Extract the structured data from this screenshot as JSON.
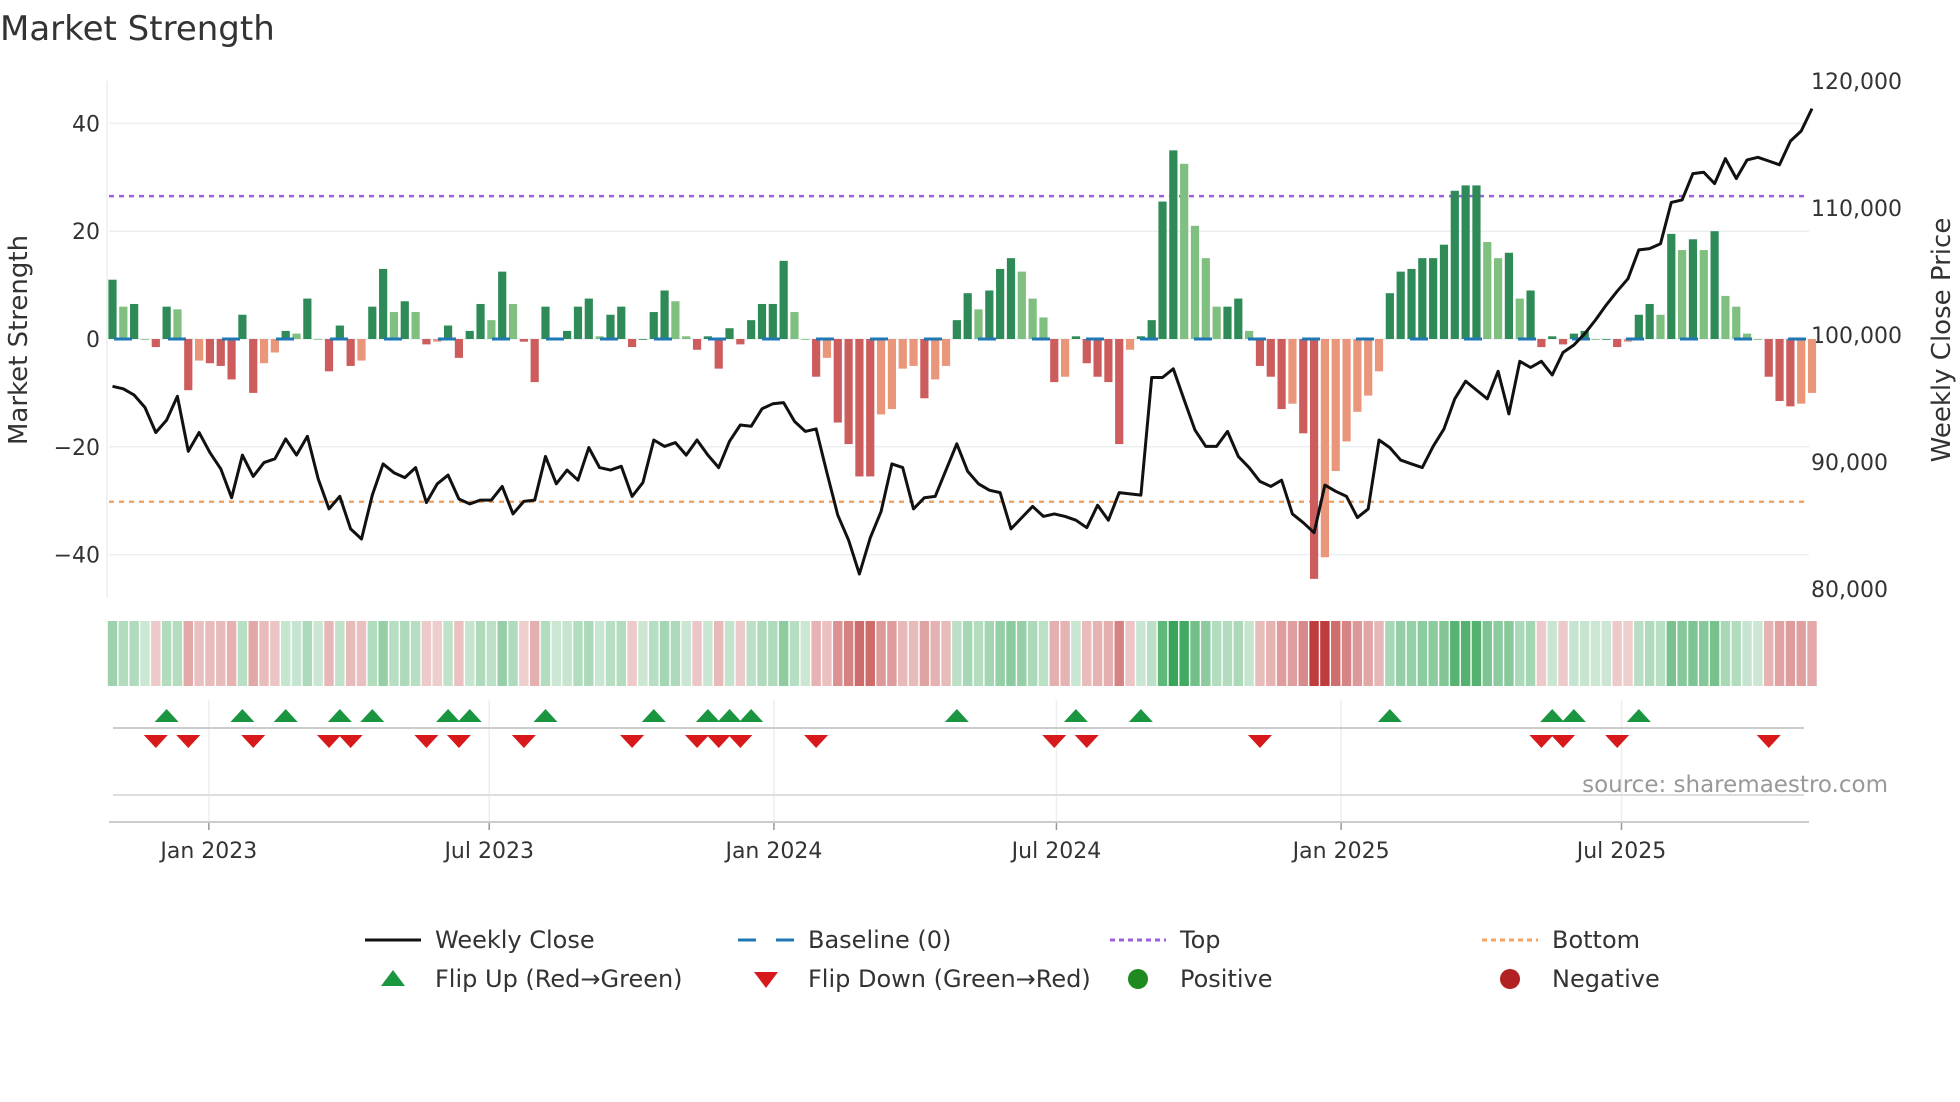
{
  "chart_data": {
    "type": "bar",
    "title": "Market Strength",
    "ylabel": "Market Strength",
    "y2label": "Weekly Close Price",
    "ylim": [
      -48,
      53
    ],
    "y2lim": [
      80000,
      120000
    ],
    "y_ticks": [
      "40",
      "20",
      "0",
      "−20",
      "−40"
    ],
    "y_tick_values": [
      40,
      20,
      0,
      -20,
      -40
    ],
    "y2_ticks": [
      "120,000",
      "110,000",
      "100,000",
      "90,000",
      "80,000"
    ],
    "y2_tick_values": [
      120000,
      110000,
      100000,
      90000,
      80000
    ],
    "x_ticks": [
      {
        "label": "Jan 2023",
        "week_index": 8.9
      },
      {
        "label": "Jul 2023",
        "week_index": 34.8
      },
      {
        "label": "Jan 2024",
        "week_index": 61.1
      },
      {
        "label": "Jul 2024",
        "week_index": 87.2
      },
      {
        "label": "Jan 2025",
        "week_index": 113.5
      },
      {
        "label": "Jul 2025",
        "week_index": 139.4
      }
    ],
    "top_level": 26.5,
    "bottom_level": -30.2,
    "strength": [
      11,
      6,
      6.5,
      0,
      -1.5,
      6,
      5.5,
      -9.5,
      -4,
      -4.5,
      -5,
      -7.5,
      4.5,
      -10,
      -4.5,
      -2.5,
      1.5,
      1,
      7.5,
      0,
      -6,
      2.5,
      -5,
      -4,
      6,
      13,
      5,
      7,
      5,
      -1,
      -0.5,
      2.5,
      -3.5,
      1.5,
      6.5,
      3.5,
      12.5,
      6.5,
      -0.5,
      -8,
      6,
      0,
      1.5,
      6,
      7.5,
      0.5,
      4.5,
      6,
      -1.5,
      0,
      5,
      9,
      7,
      0.5,
      -2,
      0.5,
      -5.5,
      2,
      -1,
      3.5,
      6.5,
      6.5,
      14.5,
      5,
      0,
      -7,
      -3.5,
      -15.5,
      -19.5,
      -25.5,
      -25.5,
      -14,
      -13,
      -5.5,
      -5,
      -11,
      -7.5,
      -5,
      3.5,
      8.5,
      5.5,
      9,
      13,
      15,
      12.5,
      7.5,
      4,
      -8,
      -7,
      0.5,
      -4.5,
      -7,
      -8,
      -19.5,
      -2,
      0.5,
      3.5,
      25.5,
      35,
      32.5,
      21,
      15,
      6,
      6,
      7.5,
      1.5,
      -5,
      -7,
      -13,
      -12,
      -17.5,
      -44.5,
      -40.5,
      -24.5,
      -19,
      -13.5,
      -10.5,
      -6,
      8.5,
      12.5,
      13,
      15,
      15,
      17.5,
      27.5,
      28.5,
      28.5,
      18,
      15,
      16,
      7.5,
      9,
      -1.5,
      0.5,
      -1,
      1,
      1.5,
      0,
      0,
      -1.5,
      -0.5,
      4.5,
      6.5,
      4.5,
      19.5,
      16.5,
      18.5,
      16.5,
      20,
      8,
      6,
      1,
      0,
      -7,
      -11.5,
      -12.5,
      -12,
      -10
    ],
    "weekly_close": [
      95960,
      95760,
      95270,
      94290,
      92320,
      93300,
      95170,
      90840,
      92320,
      90740,
      89460,
      87190,
      90540,
      88870,
      89950,
      90250,
      91820,
      90540,
      92020,
      88670,
      86310,
      87290,
      84730,
      83940,
      87390,
      89850,
      89160,
      88770,
      89560,
      86800,
      88280,
      88970,
      87090,
      86700,
      87000,
      87000,
      88080,
      85910,
      86900,
      87000,
      90440,
      88280,
      89360,
      88570,
      91130,
      89560,
      89360,
      89660,
      87290,
      88380,
      91730,
      91230,
      91530,
      90540,
      91730,
      90540,
      89560,
      91630,
      92910,
      92810,
      94190,
      94580,
      94680,
      93200,
      92410,
      92610,
      89160,
      85810,
      83840,
      81180,
      84040,
      86110,
      89850,
      89560,
      86310,
      87190,
      87290,
      89360,
      91430,
      89260,
      88280,
      87780,
      87590,
      84730,
      85620,
      86500,
      85720,
      85910,
      85720,
      85420,
      84830,
      86600,
      85420,
      87590,
      87490,
      87390,
      96650,
      96650,
      97340,
      94880,
      92510,
      91230,
      91230,
      92410,
      90440,
      89560,
      88470,
      88080,
      88570,
      85910,
      85220,
      84430,
      88180,
      87690,
      87290,
      85620,
      86310,
      91730,
      91130,
      90150,
      89850,
      89560,
      91230,
      92610,
      94980,
      96360,
      95670,
      94980,
      97140,
      93790,
      97930,
      97440,
      97930,
      96850,
      98620,
      99210,
      100100,
      101180,
      102370,
      103450,
      104430,
      106700,
      106800,
      107190,
      110440,
      110640,
      112710,
      112810,
      111920,
      113890,
      112320,
      113790,
      113990,
      113700,
      113400,
      115270,
      116060,
      117830
    ],
    "colors": {
      "strong_positive": "#2e8b57",
      "weak_positive": "#7fbf7f",
      "strong_negative": "#cd5c5c",
      "weak_negative": "#e9967a",
      "baseline": "#1f77b4",
      "top": "#9b5fe0",
      "bottom": "#f4a460",
      "flip_up": "#1a9641",
      "flip_down": "#d7191c",
      "price": "#111111"
    },
    "legend": [
      {
        "label": "Weekly Close",
        "kind": "line"
      },
      {
        "label": "Baseline (0)",
        "kind": "dash"
      },
      {
        "label": "Top",
        "kind": "dot-purple"
      },
      {
        "label": "Bottom",
        "kind": "dot-orange"
      },
      {
        "label": "Flip Up (Red→Green)",
        "kind": "tri-up"
      },
      {
        "label": "Flip Down (Green→Red)",
        "kind": "tri-down"
      },
      {
        "label": "Positive",
        "kind": "circle-green"
      },
      {
        "label": "Negative",
        "kind": "circle-red"
      }
    ],
    "legend_placement": "bottom",
    "source": "source: sharemaestro.com"
  }
}
